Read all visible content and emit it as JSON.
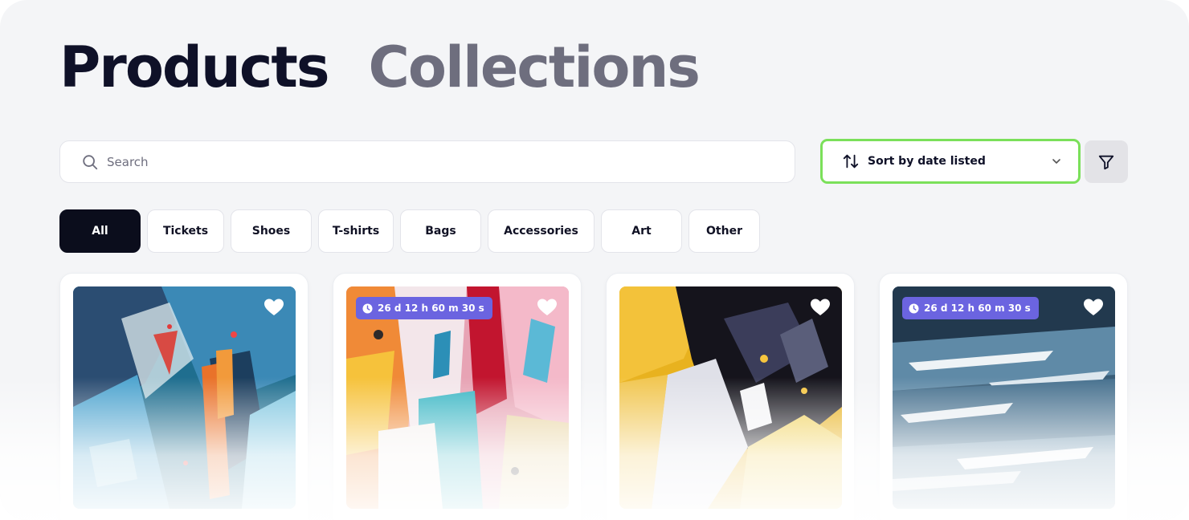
{
  "header": {
    "tabs": [
      {
        "label": "Products",
        "active": true
      },
      {
        "label": "Collections",
        "active": false
      }
    ]
  },
  "search": {
    "placeholder": "Search",
    "value": ""
  },
  "sort": {
    "label": "Sort by date listed",
    "icon": "sort-arrows-icon"
  },
  "filter": {
    "icon": "filter-icon"
  },
  "categories": [
    {
      "label": "All",
      "active": true
    },
    {
      "label": "Tickets"
    },
    {
      "label": "Shoes"
    },
    {
      "label": "T-shirts"
    },
    {
      "label": "Bags"
    },
    {
      "label": "Accessories"
    },
    {
      "label": "Art"
    },
    {
      "label": "Other"
    }
  ],
  "products": [
    {
      "timer": "",
      "favorite_icon": "heart-icon"
    },
    {
      "timer": "26 d  12 h  60 m  30 s",
      "favorite_icon": "heart-icon"
    },
    {
      "timer": "",
      "favorite_icon": "heart-icon"
    },
    {
      "timer": "26 d  12 h  60 m  30 s",
      "favorite_icon": "heart-icon"
    }
  ],
  "colors": {
    "accent_green": "#7be05a",
    "timer_badge": "#6b64e0",
    "active_chip": "#0b0d1c"
  }
}
